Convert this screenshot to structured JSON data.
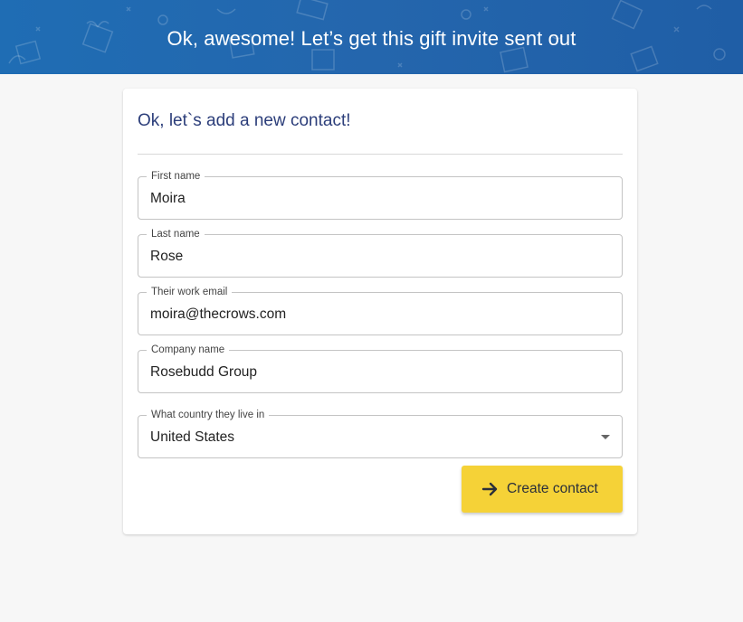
{
  "banner": {
    "title": "Ok, awesome! Let’s get this gift invite sent out",
    "background_color": "#1f6db4"
  },
  "card": {
    "title": "Ok, let`s add a new contact!"
  },
  "form": {
    "first_name": {
      "label": "First name",
      "value": "Moira"
    },
    "last_name": {
      "label": "Last name",
      "value": "Rose"
    },
    "email": {
      "label": "Their work email",
      "value": "moira@thecrows.com"
    },
    "company": {
      "label": "Company name",
      "value": "Rosebudd Group"
    },
    "country": {
      "label": "What country they live in",
      "value": "United States",
      "icon": "chevron-down-icon"
    }
  },
  "actions": {
    "create_label": "Create contact",
    "create_icon": "arrow-right-icon",
    "create_color": "#f5d237"
  }
}
